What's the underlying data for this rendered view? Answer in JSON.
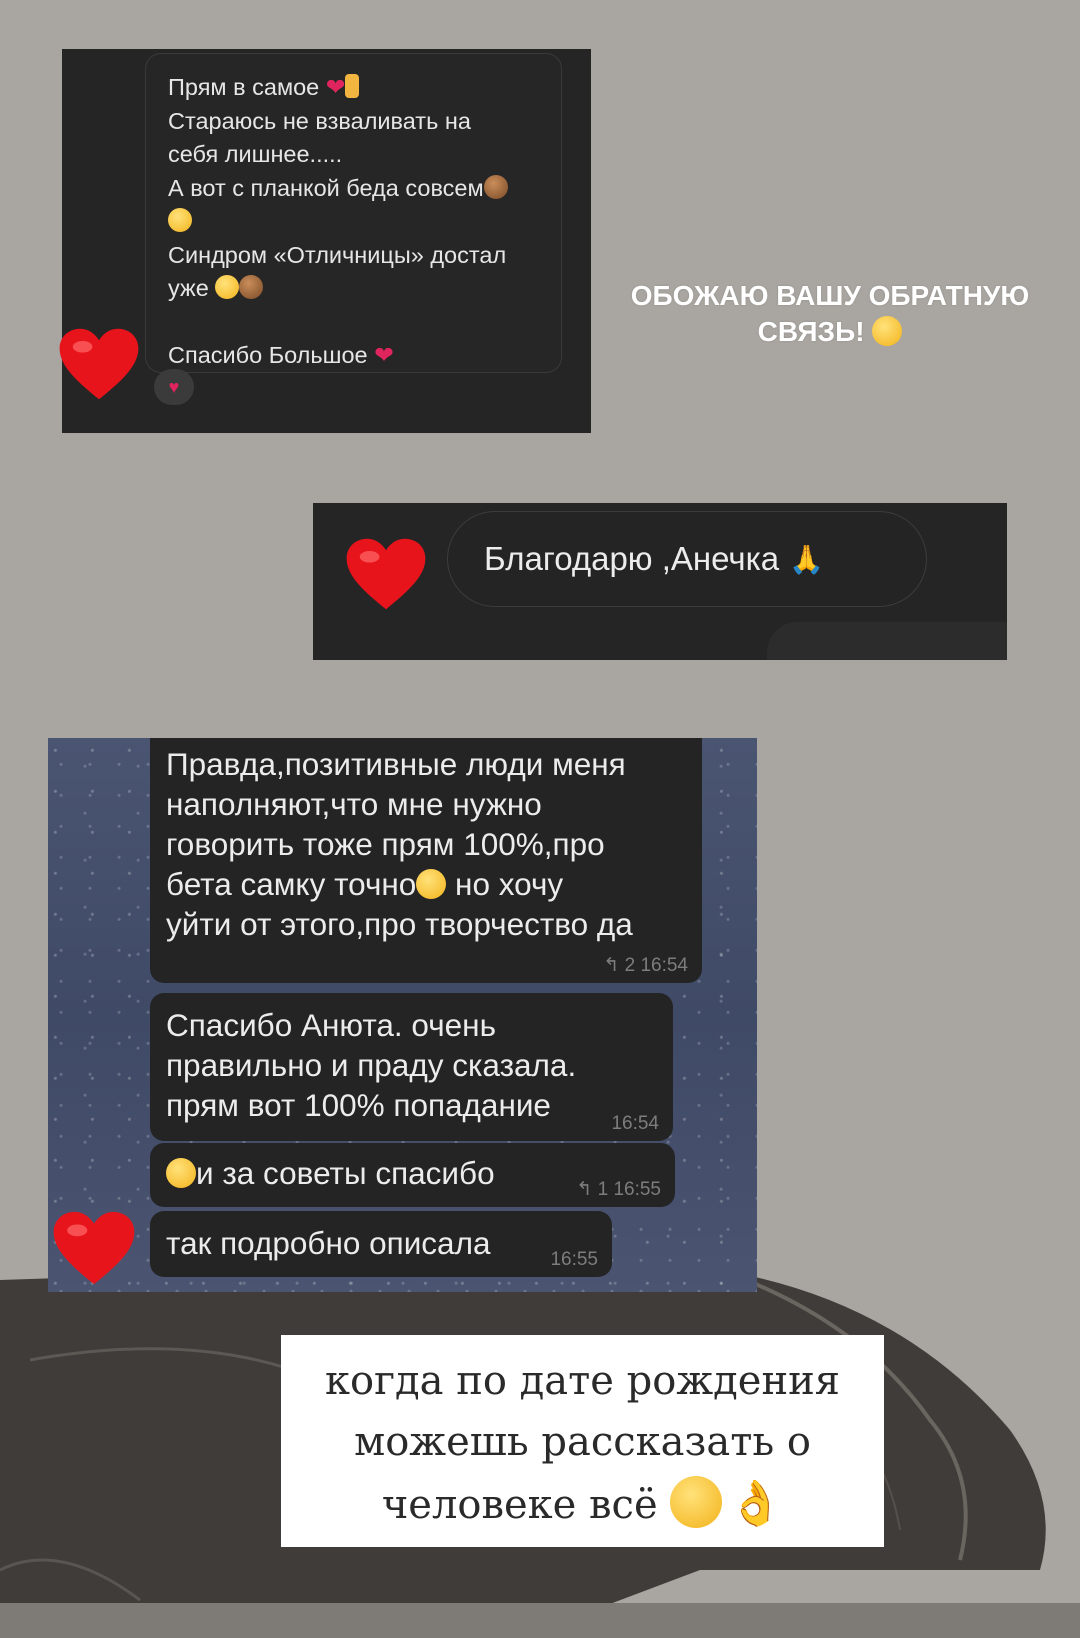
{
  "colors": {
    "background": "#a9a5a0",
    "dark_panel": "#252525",
    "heart": "#e8141c",
    "telegram_bg": "#4a5572"
  },
  "screenshot_1": {
    "lines": [
      "Прям в самое",
      "Стараюсь не взваливать на",
      "себя лишнее.....",
      "А вот с планкой беда совсем",
      "",
      "Синдром «Отличницы» достал",
      "уже",
      "",
      "Спасибо Большое"
    ],
    "reaction": "♥",
    "icons": [
      "heart-emoji",
      "thumbs-up-emoji",
      "see-no-evil-monkey-emoji",
      "grinning-face-emoji"
    ]
  },
  "caption_top": {
    "line1": "ОБОЖАЮ ВАШУ ОБРАТНУЮ",
    "line2": "СВЯЗЬ!",
    "emoji": "smiling-face-with-hearts-emoji"
  },
  "screenshot_2": {
    "message": "Благодарю ,Анечка",
    "emoji": "folded-hands-emoji"
  },
  "screenshot_3": {
    "messages": [
      {
        "lines": [
          "Правда,позитивные люди меня",
          "наполняют,что мне нужно",
          "говорить тоже прям 100%,про",
          "бета самку точно",
          "уйти от этого,про творчество да"
        ],
        "line4_suffix": " но хочу",
        "meta": "↰ 2 16:54"
      },
      {
        "lines": [
          "Спасибо Анюта. очень",
          "правильно и праду сказала.",
          "прям вот 100% попадание"
        ],
        "meta": "16:54"
      },
      {
        "lines": [
          "и за советы спасибо"
        ],
        "meta": "↰ 1 16:55"
      },
      {
        "lines": [
          "так подробно описала"
        ],
        "meta": "16:55"
      }
    ]
  },
  "caption_bottom": {
    "lines": [
      "когда по дате рождения",
      "можешь рассказать о",
      "человеке всё"
    ],
    "emojis": [
      "winking-face-emoji",
      "ok-hand-emoji"
    ]
  }
}
